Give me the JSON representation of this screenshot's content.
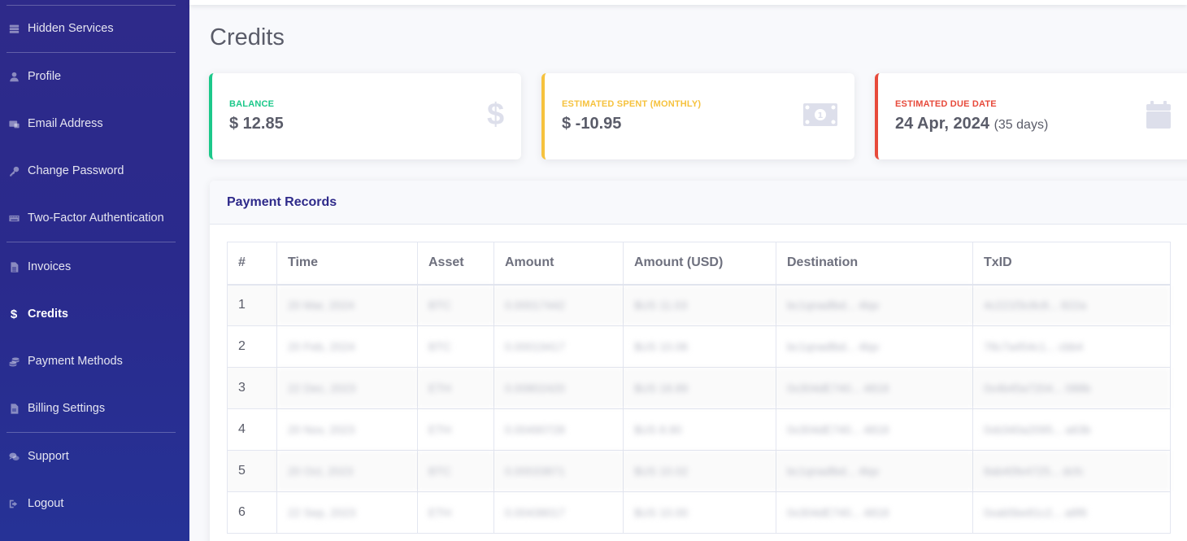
{
  "sidebar": {
    "items": [
      {
        "label": "Hidden Services",
        "icon": "server-icon"
      },
      {
        "label": "Profile",
        "icon": "user-icon"
      },
      {
        "label": "Email Address",
        "icon": "mail-icon"
      },
      {
        "label": "Change Password",
        "icon": "key-icon"
      },
      {
        "label": "Two-Factor Authentication",
        "icon": "keyboard-icon"
      },
      {
        "label": "Invoices",
        "icon": "file-invoice-icon"
      },
      {
        "label": "Credits",
        "icon": "dollar-icon",
        "active": true
      },
      {
        "label": "Payment Methods",
        "icon": "coins-icon"
      },
      {
        "label": "Billing Settings",
        "icon": "file-icon"
      },
      {
        "label": "Support",
        "icon": "comments-icon"
      },
      {
        "label": "Logout",
        "icon": "sign-out-icon"
      }
    ]
  },
  "page": {
    "title": "Credits"
  },
  "cards": {
    "balance": {
      "label": "BALANCE",
      "value": "$ 12.85",
      "icon": "dollar-icon",
      "color": "#1cc88a"
    },
    "spent": {
      "label": "ESTIMATED SPENT (MONTHLY)",
      "value": "$ -10.95",
      "icon": "money-bill-icon",
      "color": "#f6c23e"
    },
    "due": {
      "label": "ESTIMATED DUE DATE",
      "value": "24 Apr, 2024",
      "sub": "(35 days)",
      "icon": "calendar-icon",
      "color": "#e74a3b"
    }
  },
  "payments": {
    "title": "Payment Records",
    "columns": [
      "#",
      "Time",
      "Asset",
      "Amount",
      "Amount (USD)",
      "Destination",
      "TxID"
    ],
    "rows": [
      [
        "1",
        "20 Mar, 2024",
        "BTC",
        "0.00017442",
        "$US 11.03",
        "bc1qnadlbd... 4lqv",
        "4c221f3c8c8... 822a"
      ],
      [
        "2",
        "20 Feb, 2024",
        "BTC",
        "0.00019417",
        "$US 10.06",
        "bc1qnadlbd... 4lqv",
        "78c7a454c1... cbb4"
      ],
      [
        "3",
        "22 Dec, 2023",
        "ETH",
        "0.00802420",
        "$US 18.89",
        "0x304dE740... 4818",
        "0x4b45a7204... 088b"
      ],
      [
        "4",
        "20 Nov, 2023",
        "ETH",
        "0.00490728",
        "$US 8.90",
        "0x304dE740... 4818",
        "0xb340a2095... a63b"
      ],
      [
        "5",
        "20 Oct, 2023",
        "BTC",
        "0.00033871",
        "$US 10.02",
        "bc1qnadlbd... 4lqv",
        "8ab40fe4725... dcfc"
      ],
      [
        "6",
        "22 Sep, 2023",
        "ETH",
        "0.00438017",
        "$US 10.00",
        "0x304dE740... 4818",
        "0xab5be81c2... a8f6"
      ]
    ]
  }
}
